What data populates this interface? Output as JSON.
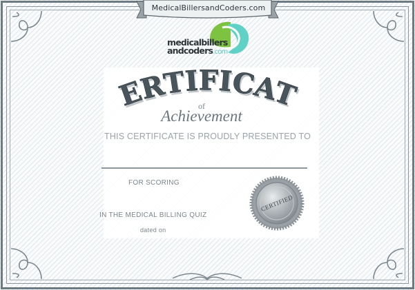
{
  "ribbon": {
    "website": "MedicalBillersandCoders.com"
  },
  "logo": {
    "line1": "medicalbillers",
    "line2": "andcoders",
    "suffix": ".com"
  },
  "heading": {
    "title": "CERTIFICATE",
    "connector": "of",
    "subtitle": "Achievement"
  },
  "body": {
    "presented_line": "THIS CERTIFICATE IS PROUDLY PRESENTED TO",
    "scoring_label": "FOR SCORING",
    "quiz_line": "IN THE MEDICAL BILLING QUIZ",
    "dated_label": "dated on"
  },
  "seal": {
    "text": "CERTIFIED"
  },
  "colors": {
    "frame": "#6d7a82",
    "stripes": "#e1e6e9",
    "logo_green": "#7ec242",
    "logo_teal": "#5fd1c6",
    "seal_silver": "#a7adb1"
  }
}
